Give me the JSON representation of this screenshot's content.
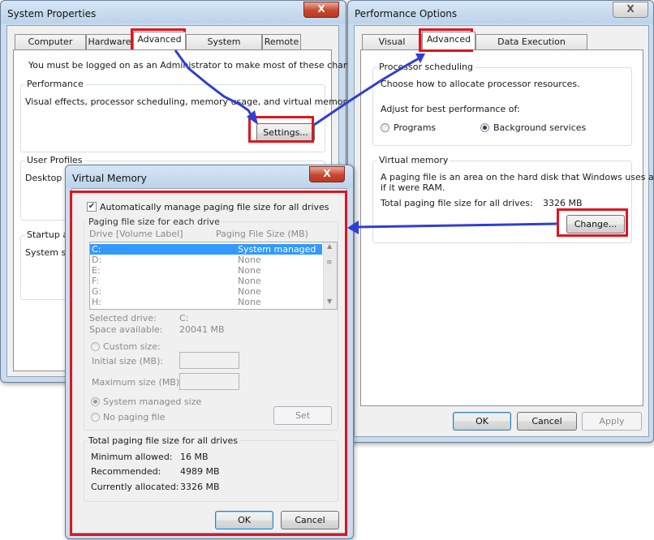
{
  "system_properties": {
    "title": "System Properties",
    "close": "X",
    "tabs": [
      "Computer Name",
      "Hardware",
      "Advanced",
      "System Protection",
      "Remote"
    ],
    "admin_note": "You must be logged on as an Administrator to make most of these changes.",
    "performance": {
      "label": "Performance",
      "description": "Visual effects, processor scheduling, memory usage, and virtual memory",
      "settings_button": "Settings..."
    },
    "user_profiles": {
      "label": "User Profiles",
      "description_start": "Desktop"
    },
    "startup": {
      "label": "Startup a",
      "description_start": "System s"
    }
  },
  "performance_options": {
    "title": "Performance Options",
    "close": "X",
    "tabs": [
      "Visual Effects",
      "Advanced",
      "Data Execution Prevention"
    ],
    "processor_scheduling": {
      "label": "Processor scheduling",
      "description": "Choose how to allocate processor resources.",
      "adjust_label": "Adjust for best performance of:",
      "option_programs": "Programs",
      "option_background": "Background services"
    },
    "virtual_memory": {
      "label": "Virtual memory",
      "description_line1": "A paging file is an area on the hard disk that Windows uses as",
      "description_line2": "if it were RAM.",
      "total_label": "Total paging file size for all drives:",
      "total_value": "3326 MB",
      "change_button": "Change..."
    },
    "ok": "OK",
    "cancel": "Cancel",
    "apply": "Apply"
  },
  "virtual_memory_dialog": {
    "title": "Virtual Memory",
    "close": "X",
    "auto_manage_label": "Automatically manage paging file size for all drives",
    "group_label": "Paging file size for each drive",
    "col_drive": "Drive  [Volume Label]",
    "col_size": "Paging File Size (MB)",
    "drives": [
      {
        "drive": "C:",
        "size": "System managed"
      },
      {
        "drive": "D:",
        "size": "None"
      },
      {
        "drive": "E:",
        "size": "None"
      },
      {
        "drive": "F:",
        "size": "None"
      },
      {
        "drive": "G:",
        "size": "None"
      },
      {
        "drive": "H:",
        "size": "None"
      }
    ],
    "selected_drive_label": "Selected drive:",
    "selected_drive_value": "C:",
    "space_available_label": "Space available:",
    "space_available_value": "20041 MB",
    "custom_size_label": "Custom size:",
    "initial_size_label": "Initial size (MB):",
    "maximum_size_label": "Maximum size (MB):",
    "system_managed_label": "System managed size",
    "no_paging_label": "No paging file",
    "set_button": "Set",
    "totals_label": "Total paging file size for all drives",
    "min_allowed_label": "Minimum allowed:",
    "min_allowed_value": "16 MB",
    "recommended_label": "Recommended:",
    "recommended_value": "4989 MB",
    "allocated_label": "Currently allocated:",
    "allocated_value": "3326 MB",
    "ok": "OK",
    "cancel": "Cancel"
  },
  "colors": {
    "highlight_red": "#e0141e",
    "arrow_blue": "#2f3fd0",
    "selection_blue": "#3399ff"
  }
}
